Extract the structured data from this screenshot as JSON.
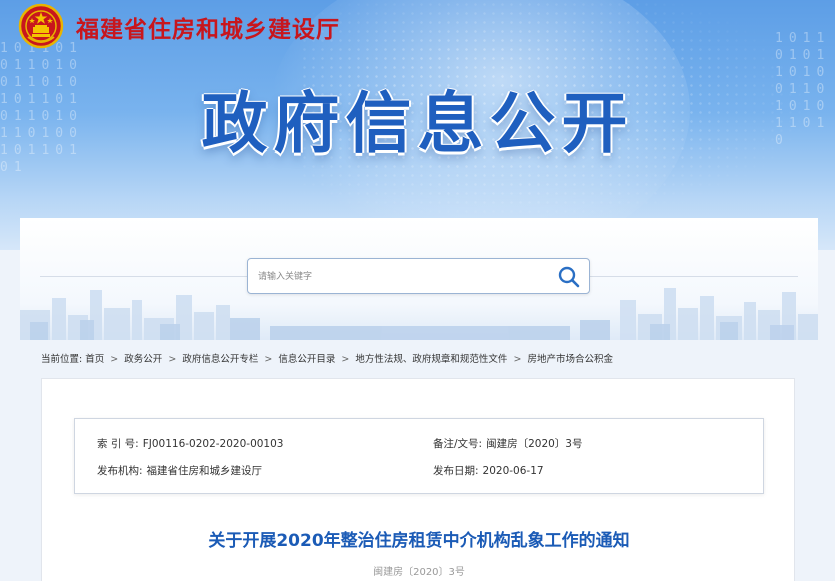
{
  "header": {
    "site_name": "福建省住房和城乡建设厅",
    "section_title": "政府信息公开",
    "digits_left": "10110101101001101010110101101011010010110101",
    "digits_right": "1011010110100110101011010"
  },
  "search": {
    "placeholder": "请输入关键字"
  },
  "breadcrumb": {
    "label": "当前位置:",
    "items": [
      "首页",
      "政务公开",
      "政府信息公开专栏",
      "信息公开目录",
      "地方性法规、政府规章和规范性文件",
      "房地产市场合公积金"
    ],
    "separator": ">"
  },
  "meta": {
    "index_label": "索 引 号:",
    "index_value": "FJ00116-0202-2020-00103",
    "docno_label": "备注/文号:",
    "docno_value": "闽建房〔2020〕3号",
    "org_label": "发布机构:",
    "org_value": "福建省住房和城乡建设厅",
    "date_label": "发布日期:",
    "date_value": "2020-06-17"
  },
  "article": {
    "title": "关于开展2020年整治住房租赁中介机构乱象工作的通知",
    "doc_number": "闽建房〔2020〕3号"
  },
  "colors": {
    "brand_red": "#c8161d",
    "title_blue": "#1f5fbf",
    "link_blue": "#1b5bb6"
  }
}
